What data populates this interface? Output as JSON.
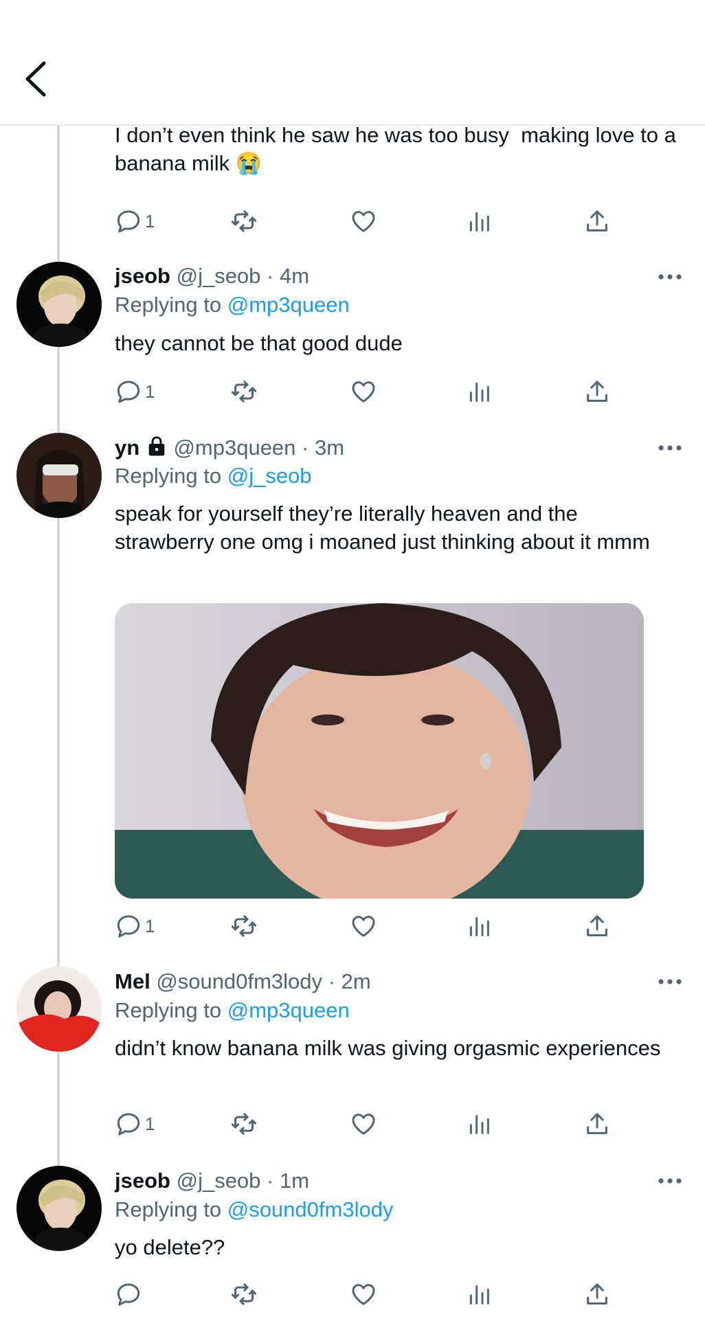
{
  "colors": {
    "accent": "#1d9bf0",
    "secondary_text": "#536471",
    "primary_text": "#0f1419",
    "thread_line": "#cfd9de"
  },
  "header": {
    "back_icon": "chevron-left-icon"
  },
  "tweets": [
    {
      "text": "I don’t even think he saw he was too busy  making love to a banana milk 😭",
      "reply_count": "1"
    },
    {
      "name": "jseob",
      "handle": "@j_seob · 4m",
      "replying_prefix": "Replying to ",
      "replying_to": "@mp3queen",
      "text": "they cannot be that good dude",
      "reply_count": "1"
    },
    {
      "name": "yn",
      "handle": "@mp3queen · 3m",
      "replying_prefix": "Replying to ",
      "replying_to": "@j_seob",
      "text": "speak for yourself they’re literally heaven and the strawberry one omg i moaned just thinking about it mmm",
      "has_media": true,
      "reply_count": "1"
    },
    {
      "name": "Mel",
      "handle": "@sound0fm3lody · 2m",
      "replying_prefix": "Replying to ",
      "replying_to": "@mp3queen",
      "text": "didn’t know banana milk was giving orgasmic experiences",
      "reply_count": "1"
    },
    {
      "name": "jseob",
      "handle": "@j_seob · 1m",
      "replying_prefix": "Replying to ",
      "replying_to": "@sound0fm3lody",
      "text": "yo delete??",
      "reply_count": ""
    }
  ]
}
